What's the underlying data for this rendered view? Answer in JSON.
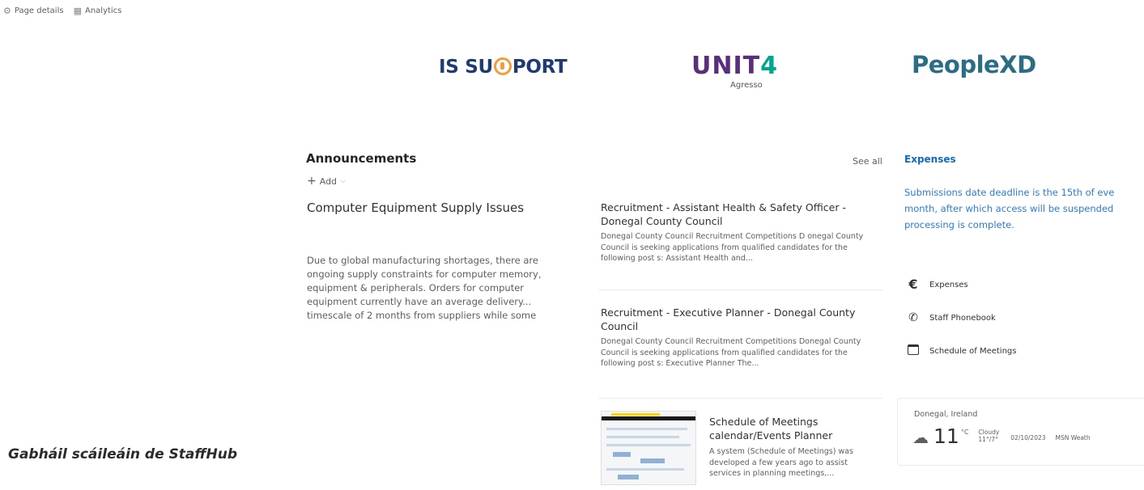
{
  "command_bar": {
    "page_details_label": "Page details",
    "analytics_label": "Analytics",
    "page_details_icon": "gear-icon",
    "analytics_icon": "analytics-icon"
  },
  "logos": {
    "is_support": {
      "text_before": "IS SU",
      "text_after": "PORT",
      "color": "#1f3b73",
      "accent": "#f39c3b"
    },
    "unit4": {
      "text": "UNIT",
      "digit": "4",
      "subtitle": "Agresso",
      "color": "#5a2e7c",
      "accent": "#00a88f"
    },
    "peoplexd": {
      "text": "PeopleXD",
      "color": "#2b6d84"
    }
  },
  "announcements": {
    "title": "Announcements",
    "add_label": "Add",
    "see_all_label": "See all",
    "hero": {
      "title": "Computer Equipment Supply Issues",
      "description": "Due to global manufacturing shortages, there are ongoing supply constraints for computer memory, equipment & peripherals. Orders for computer equipment currently have an average delivery... timescale of 2 months from suppliers while some"
    },
    "items": [
      {
        "title": "Recruitment - Assistant Health & Safety Officer - Donegal County Council",
        "snippet": "Donegal County Council Recruitment Competitions D onegal County Council is seeking applications from qualified candidates for the following post s: Assistant Health and..."
      },
      {
        "title": "Recruitment - Executive Planner - Donegal County Council",
        "snippet": "Donegal County Council Recruitment Competitions Donegal County Council is seeking applications from qualified candidates for the following post s: Executive Planner The..."
      },
      {
        "title": "Schedule of Meetings calendar/Events Planner",
        "snippet": "A system (Schedule of Meetings) was developed a few years ago to assist services in planning meetings,..."
      }
    ]
  },
  "expenses": {
    "title": "Expenses",
    "description_lines": [
      "Submissions date deadline is the 15th of eve",
      "month, after which access will be suspended",
      "processing is complete."
    ],
    "links": [
      {
        "label": "Expenses",
        "icon": "euro-icon"
      },
      {
        "label": "Staff Phonebook",
        "icon": "phone-icon"
      },
      {
        "label": "Schedule of Meetings",
        "icon": "calendar-icon"
      }
    ],
    "link_color": "#2b7cd3"
  },
  "weather": {
    "location": "Donegal, Ireland",
    "temperature": "11",
    "unit": "°C",
    "condition": "Cloudy",
    "range": "11°/7°",
    "date": "02/10/2023",
    "source": "MSN Weath"
  },
  "caption": "Gabháil scáileáin de StaffHub"
}
